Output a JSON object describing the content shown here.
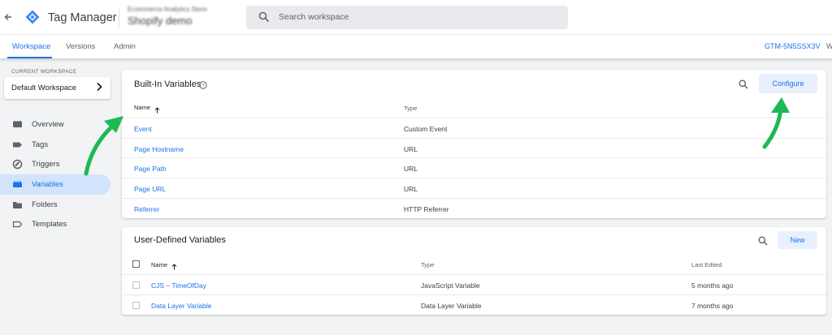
{
  "header": {
    "app_title": "Tag Manager",
    "account_name": "Ecommerce Analytics Store",
    "container_name": "Shopify demo",
    "search_placeholder": "Search workspace"
  },
  "subnav": {
    "tabs": [
      {
        "label": "Workspace"
      },
      {
        "label": "Versions"
      },
      {
        "label": "Admin"
      }
    ],
    "container_id": "GTM-5N5SSX3V",
    "workspace_cut": "W"
  },
  "sidebar": {
    "current_workspace_label": "CURRENT WORKSPACE",
    "workspace_name": "Default Workspace",
    "items": [
      {
        "label": "Overview",
        "icon": "overview-icon"
      },
      {
        "label": "Tags",
        "icon": "tag-icon"
      },
      {
        "label": "Triggers",
        "icon": "trigger-icon"
      },
      {
        "label": "Variables",
        "icon": "variables-icon"
      },
      {
        "label": "Folders",
        "icon": "folder-icon"
      },
      {
        "label": "Templates",
        "icon": "template-icon"
      }
    ]
  },
  "builtin": {
    "title": "Built-In Variables",
    "configure_label": "Configure",
    "col_name": "Name",
    "col_type": "Type",
    "rows": [
      {
        "name": "Event",
        "type": "Custom Event"
      },
      {
        "name": "Page Hostname",
        "type": "URL"
      },
      {
        "name": "Page Path",
        "type": "URL"
      },
      {
        "name": "Page URL",
        "type": "URL"
      },
      {
        "name": "Referrer",
        "type": "HTTP Referrer"
      }
    ]
  },
  "userdefined": {
    "title": "User-Defined Variables",
    "new_label": "New",
    "col_name": "Name",
    "col_type": "Type",
    "col_edited": "Last Edited",
    "rows": [
      {
        "name": "CJS – TimeOfDay",
        "type": "JavaScript Variable",
        "edited": "5 months ago"
      },
      {
        "name": "Data Layer Variable",
        "type": "Data Layer Variable",
        "edited": "7 months ago"
      }
    ]
  },
  "colors": {
    "accent": "#1a73e8",
    "active_nav_bg": "#d2e3fc",
    "annotation_arrow": "#1db954",
    "logo_blue": "#4285f4"
  }
}
